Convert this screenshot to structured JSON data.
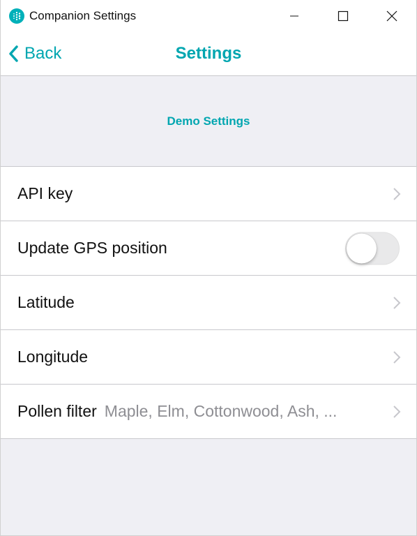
{
  "window": {
    "title": "Companion Settings",
    "icon": "fitbit-app-icon",
    "controls": [
      "minimize-icon",
      "maximize-icon",
      "close-icon"
    ]
  },
  "nav": {
    "back_label": "Back",
    "title": "Settings"
  },
  "section": {
    "title": "Demo Settings"
  },
  "rows": [
    {
      "label": "API key",
      "value": "",
      "control": "chevron"
    },
    {
      "label": "Update GPS position",
      "value": "",
      "control": "toggle",
      "toggle_on": false
    },
    {
      "label": "Latitude",
      "value": "",
      "control": "chevron"
    },
    {
      "label": "Longitude",
      "value": "",
      "control": "chevron"
    },
    {
      "label": "Pollen filter",
      "value": "Maple, Elm, Cottonwood, Ash, ...",
      "control": "chevron"
    }
  ],
  "colors": {
    "accent": "#00a6b0",
    "background": "#efeff4",
    "separator": "#c8c8cc",
    "secondary_text": "#8e8e93"
  }
}
